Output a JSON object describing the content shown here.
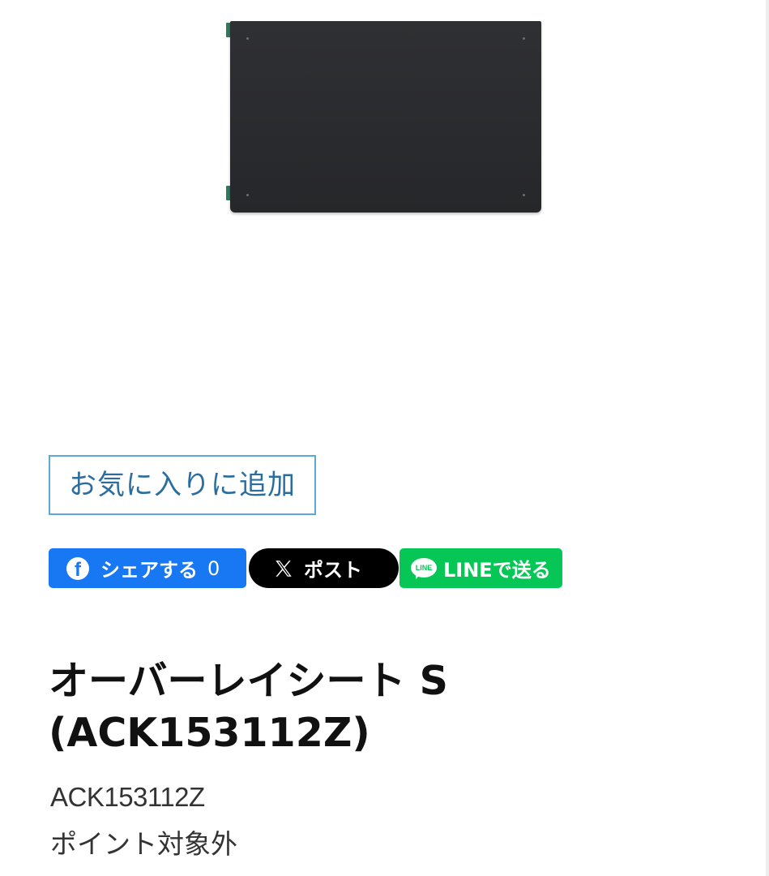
{
  "product": {
    "image_alt": "オーバーレイシート S",
    "title": "オーバーレイシート S (ACK153112Z)",
    "code": "ACK153112Z",
    "points_note": "ポイント対象外"
  },
  "favorite": {
    "label": "お気に入りに追加"
  },
  "share": {
    "facebook_label": "シェアする",
    "facebook_count": "0",
    "x_label": "ポスト",
    "line_label": "LINEで送る",
    "line_icon_text": "LINE"
  },
  "colors": {
    "facebook": "#1877f2",
    "x": "#000000",
    "line": "#06c755",
    "favorite_border": "#5aa9d6",
    "favorite_text": "#2a6d9e"
  }
}
